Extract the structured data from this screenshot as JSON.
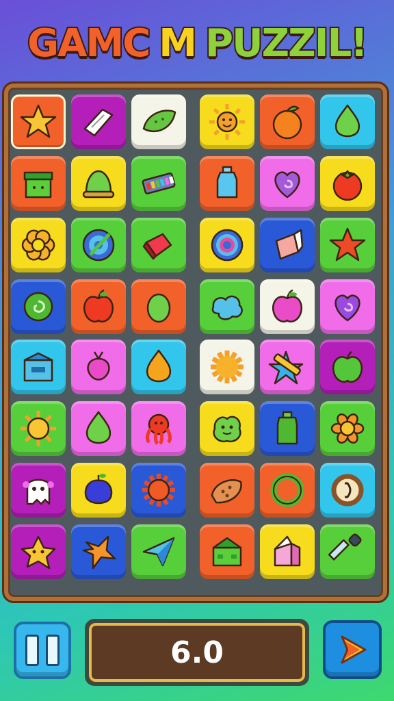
{
  "title": {
    "part1": "GAMC",
    "part2": "M",
    "part3": "PUZZIL!"
  },
  "hud": {
    "score": "6.0"
  },
  "colors": {
    "orange": "#f2612a",
    "magenta": "#b31fb8",
    "cream": "#f4f4e8",
    "yellow": "#f6dc1c",
    "cyan": "#33c6ec",
    "green": "#57cf3a",
    "pink": "#f06ce8",
    "blue": "#2a59d8",
    "red": "#ea5524"
  },
  "grid": [
    [
      {
        "color": "orange",
        "icon": "star-icon",
        "selected": true
      },
      {
        "color": "magenta",
        "icon": "paper-icon"
      },
      {
        "color": "cream",
        "icon": "leaf-icon"
      },
      {
        "color": "yellow",
        "icon": "sun-face-icon"
      },
      {
        "color": "orange",
        "icon": "orange-fruit-icon"
      },
      {
        "color": "cyan",
        "icon": "green-drop-icon"
      }
    ],
    [
      {
        "color": "orange",
        "icon": "green-box-icon"
      },
      {
        "color": "yellow",
        "icon": "green-bell-icon"
      },
      {
        "color": "green",
        "icon": "keyboard-icon"
      },
      {
        "color": "orange",
        "icon": "bottle-icon"
      },
      {
        "color": "pink",
        "icon": "swirl-heart-icon"
      },
      {
        "color": "yellow",
        "icon": "tomato-icon"
      }
    ],
    [
      {
        "color": "yellow",
        "icon": "flower-icon"
      },
      {
        "color": "green",
        "icon": "target-icon"
      },
      {
        "color": "green",
        "icon": "red-gem-icon"
      },
      {
        "color": "yellow",
        "icon": "spiral-icon"
      },
      {
        "color": "blue",
        "icon": "paper-box-icon"
      },
      {
        "color": "green",
        "icon": "red-star-icon"
      }
    ],
    [
      {
        "color": "blue",
        "icon": "green-swirl-icon"
      },
      {
        "color": "orange",
        "icon": "red-apple-icon"
      },
      {
        "color": "orange",
        "icon": "green-egg-icon"
      },
      {
        "color": "green",
        "icon": "blue-splat-icon"
      },
      {
        "color": "cream",
        "icon": "pink-apple-icon"
      },
      {
        "color": "pink",
        "icon": "purple-swirl-icon"
      }
    ],
    [
      {
        "color": "cyan",
        "icon": "blue-box-icon"
      },
      {
        "color": "pink",
        "icon": "pink-radish-icon"
      },
      {
        "color": "cyan",
        "icon": "orange-drop-icon"
      },
      {
        "color": "cream",
        "icon": "orange-burst-icon"
      },
      {
        "color": "pink",
        "icon": "crayon-star-icon"
      },
      {
        "color": "magenta",
        "icon": "green-apple-icon"
      }
    ],
    [
      {
        "color": "green",
        "icon": "yellow-sun-icon"
      },
      {
        "color": "pink",
        "icon": "green-drop-icon"
      },
      {
        "color": "pink",
        "icon": "red-octopus-icon"
      },
      {
        "color": "yellow",
        "icon": "green-blob-icon"
      },
      {
        "color": "blue",
        "icon": "green-jar-icon"
      },
      {
        "color": "green",
        "icon": "orange-flower-icon"
      }
    ],
    [
      {
        "color": "magenta",
        "icon": "ghost-icon"
      },
      {
        "color": "yellow",
        "icon": "blue-plum-icon"
      },
      {
        "color": "blue",
        "icon": "red-sun-icon"
      },
      {
        "color": "orange",
        "icon": "cookie-icon"
      },
      {
        "color": "orange",
        "icon": "green-ring-icon"
      },
      {
        "color": "cyan",
        "icon": "brown-ring-icon"
      }
    ],
    [
      {
        "color": "magenta",
        "icon": "cheese-icon"
      },
      {
        "color": "blue",
        "icon": "orange-star-icon"
      },
      {
        "color": "green",
        "icon": "paper-plane-icon"
      },
      {
        "color": "orange",
        "icon": "green-house-icon"
      },
      {
        "color": "yellow",
        "icon": "pink-box-icon"
      },
      {
        "color": "green",
        "icon": "dropper-icon"
      }
    ]
  ]
}
